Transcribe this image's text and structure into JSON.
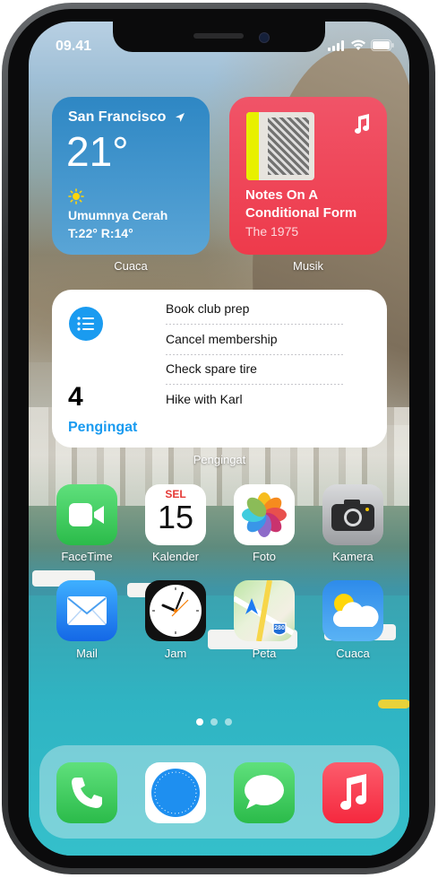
{
  "status_bar": {
    "time": "09.41"
  },
  "widgets": {
    "weather": {
      "city": "San Francisco",
      "temperature": "21°",
      "condition": "Umumnya Cerah",
      "high_low": "T:22° R:14°",
      "label": "Cuaca",
      "icon": "sun-icon"
    },
    "music": {
      "song": "Notes On A Conditional Form",
      "artist": "The 1975",
      "label": "Musik",
      "icon": "music-note-icon"
    },
    "reminders": {
      "count": "4",
      "title": "Pengingat",
      "label": "Pengingat",
      "items": [
        "Book club prep",
        "Cancel membership",
        "Check spare tire",
        "Hike with Karl"
      ],
      "accent": "#1a9bf0"
    }
  },
  "apps": [
    {
      "label": "FaceTime",
      "icon": "facetime-icon"
    },
    {
      "label": "Kalender",
      "icon": "calendar-icon",
      "day": "SEL",
      "date": "15"
    },
    {
      "label": "Foto",
      "icon": "photos-icon"
    },
    {
      "label": "Kamera",
      "icon": "camera-icon"
    },
    {
      "label": "Mail",
      "icon": "mail-icon"
    },
    {
      "label": "Jam",
      "icon": "clock-icon"
    },
    {
      "label": "Peta",
      "icon": "maps-icon",
      "road": "280"
    },
    {
      "label": "Cuaca",
      "icon": "weather-icon"
    }
  ],
  "dock": [
    {
      "icon": "phone-icon"
    },
    {
      "icon": "safari-icon"
    },
    {
      "icon": "messages-icon"
    },
    {
      "icon": "music-icon"
    }
  ],
  "page_indicator": {
    "count": 3,
    "active": 1
  },
  "colors": {
    "facetime": "#34c759",
    "messages": "#34c759",
    "music_red": "#fa3c50",
    "mail_blue": "#1d8cf0",
    "calendar_red": "#e53935"
  }
}
